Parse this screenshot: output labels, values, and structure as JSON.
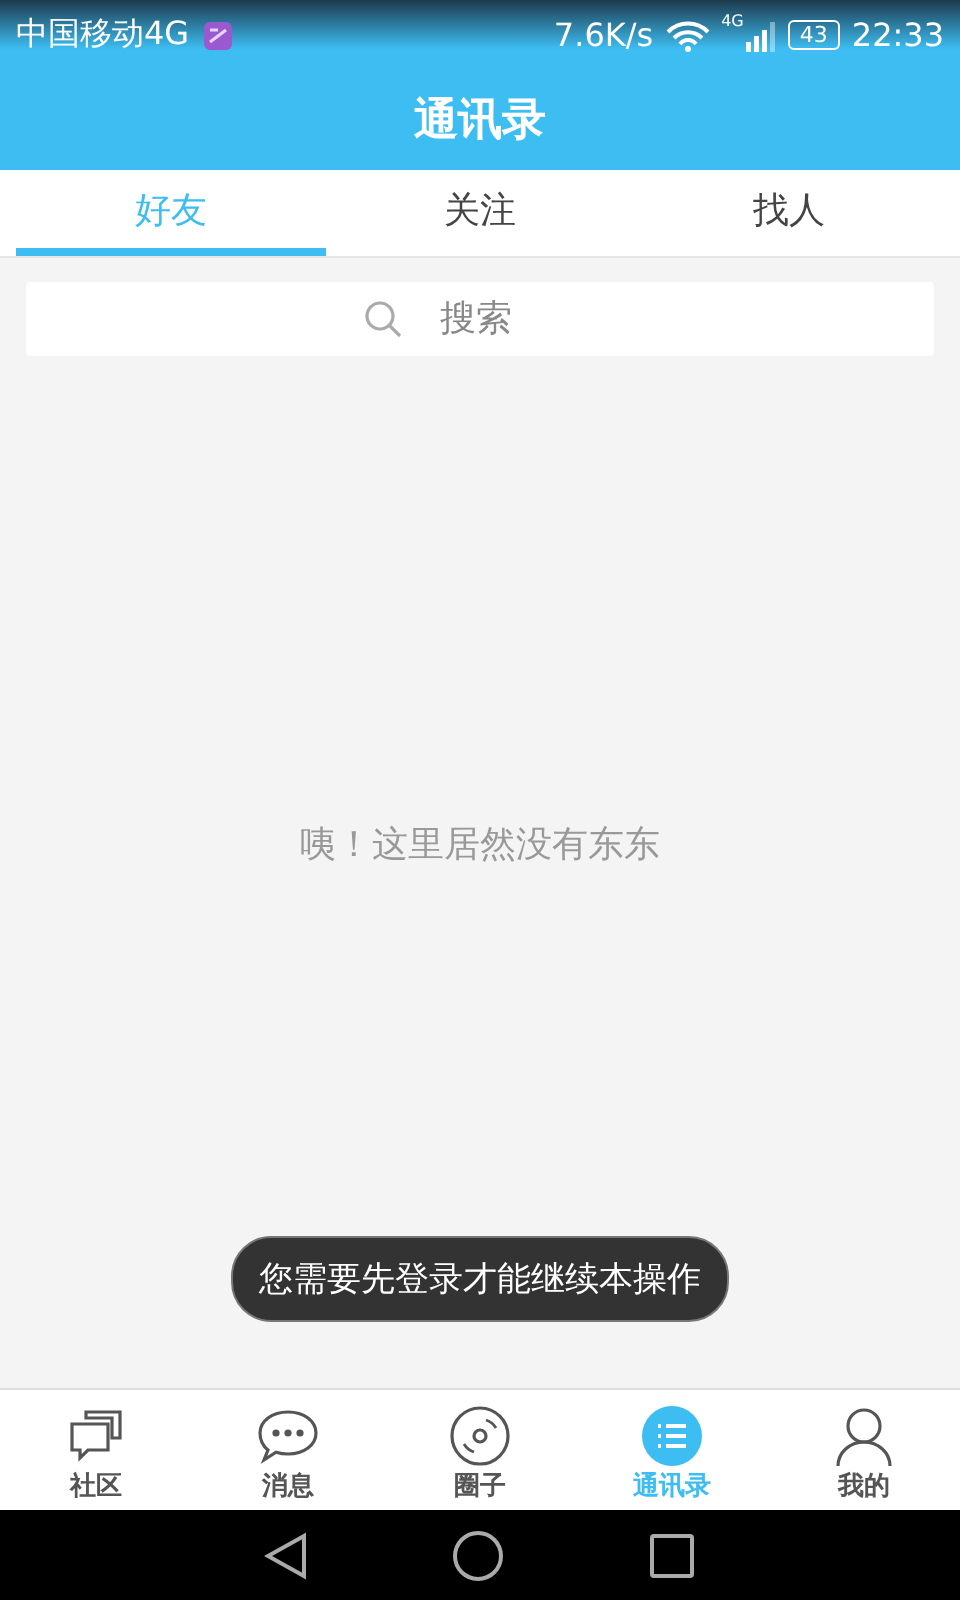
{
  "status_bar": {
    "carrier": "中国移动4G",
    "speed": "7.6K/s",
    "network": "4G",
    "battery": "43",
    "time": "22:33"
  },
  "title": "通讯录",
  "tabs": [
    {
      "label": "好友",
      "selected": true
    },
    {
      "label": "关注",
      "selected": false
    },
    {
      "label": "找人",
      "selected": false
    }
  ],
  "search": {
    "placeholder": "搜索"
  },
  "empty_message": "咦！这里居然没有东东",
  "toast": "您需要先登录才能继续本操作",
  "bottom_nav": [
    {
      "label": "社区",
      "kind": "community",
      "selected": false
    },
    {
      "label": "消息",
      "kind": "messages",
      "selected": false
    },
    {
      "label": "圈子",
      "kind": "circle",
      "selected": false
    },
    {
      "label": "通讯录",
      "kind": "contacts",
      "selected": true
    },
    {
      "label": "我的",
      "kind": "me",
      "selected": false
    }
  ]
}
